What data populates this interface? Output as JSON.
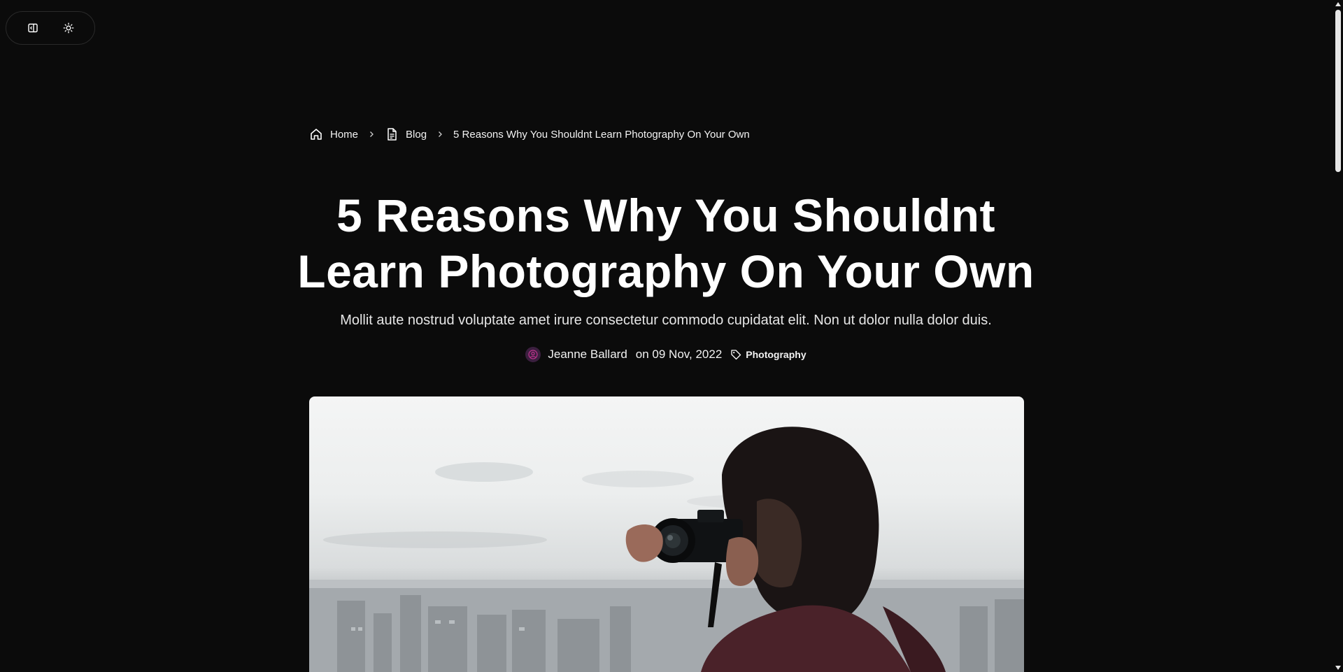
{
  "toolbar": {
    "buttons": [
      {
        "icon": "sidebar-toggle-icon"
      },
      {
        "icon": "sun-icon"
      }
    ]
  },
  "breadcrumb": {
    "home": {
      "label": "Home",
      "icon": "home-icon"
    },
    "blog": {
      "label": "Blog",
      "icon": "document-icon"
    },
    "current": {
      "label": "5 Reasons Why You Shouldnt Learn Photography On Your Own"
    }
  },
  "post": {
    "title": "5 Reasons Why You Shouldnt Learn Photography On Your Own",
    "subtitle": "Mollit aute nostrud voluptate amet irure consectetur commodo cupidatat elit. Non ut dolor nulla dolor duis.",
    "author": "Jeanne Ballard",
    "date": "on 09 Nov, 2022",
    "tag": "Photography"
  },
  "colors": {
    "background": "#0b0b0b",
    "text": "#ffffff",
    "avatar_accent": "#c0338f"
  }
}
